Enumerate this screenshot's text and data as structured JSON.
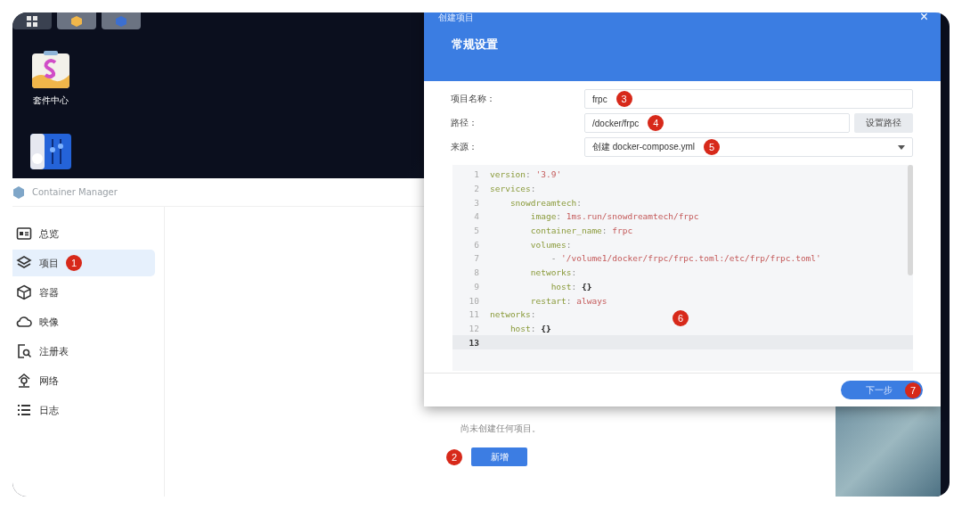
{
  "desktop": {
    "icons": [
      {
        "label": "套件中心",
        "kind": "store"
      },
      {
        "kind": "settings"
      }
    ],
    "taskbar": [
      {
        "kind": "grid",
        "selected": false
      },
      {
        "kind": "store",
        "selected": true
      },
      {
        "kind": "container",
        "selected": true
      }
    ]
  },
  "app_window": {
    "title": "Container Manager",
    "sidebar": {
      "items": [
        {
          "label": "总览",
          "kind": "overview",
          "selected": false
        },
        {
          "label": "项目",
          "kind": "layers",
          "selected": true,
          "badge": "1"
        },
        {
          "label": "容器",
          "kind": "cube",
          "selected": false
        },
        {
          "label": "映像",
          "kind": "cloud",
          "selected": false
        },
        {
          "label": "注册表",
          "kind": "registry",
          "selected": false
        },
        {
          "label": "网络",
          "kind": "network",
          "selected": false
        },
        {
          "label": "日志",
          "kind": "list",
          "selected": false
        }
      ]
    },
    "empty_message": "尚未创建任何项目。",
    "add_button": {
      "label": "新增",
      "badge": "2"
    }
  },
  "dialog": {
    "title": "创建项目",
    "close": "×",
    "heading": "常规设置",
    "fields": [
      {
        "label": "项目名称：",
        "value": "frpc",
        "kind": "text",
        "badge": "3"
      },
      {
        "label": "路径：",
        "value": "/docker/frpc",
        "kind": "path",
        "button": "设置路径",
        "badge": "4"
      },
      {
        "label": "来源：",
        "value": "创建 docker-compose.yml",
        "kind": "select",
        "badge": "5"
      }
    ],
    "editor": {
      "badge": "6",
      "lines": [
        {
          "number": "1",
          "selected": false,
          "tokens": [
            {
              "text": "version",
              "kind": "key"
            },
            {
              "text": ": ",
              "kind": "punct"
            },
            {
              "text": "'3.9'",
              "kind": "string"
            }
          ]
        },
        {
          "number": "2",
          "selected": false,
          "tokens": [
            {
              "text": "services",
              "kind": "key"
            },
            {
              "text": ":",
              "kind": "punct"
            }
          ]
        },
        {
          "number": "3",
          "selected": false,
          "tokens": [
            {
              "text": "    snowdreamtech",
              "kind": "key"
            },
            {
              "text": ":",
              "kind": "punct"
            }
          ]
        },
        {
          "number": "4",
          "selected": false,
          "tokens": [
            {
              "text": "        image",
              "kind": "key"
            },
            {
              "text": ": ",
              "kind": "punct"
            },
            {
              "text": "1ms.run/snowdreamtech/frpc",
              "kind": "string"
            }
          ]
        },
        {
          "number": "5",
          "selected": false,
          "tokens": [
            {
              "text": "        container_name",
              "kind": "key"
            },
            {
              "text": ": ",
              "kind": "punct"
            },
            {
              "text": "frpc",
              "kind": "string"
            }
          ]
        },
        {
          "number": "6",
          "selected": false,
          "tokens": [
            {
              "text": "        volumes",
              "kind": "key"
            },
            {
              "text": ":",
              "kind": "punct"
            }
          ]
        },
        {
          "number": "7",
          "selected": false,
          "tokens": [
            {
              "text": "            - ",
              "kind": "punct"
            },
            {
              "text": "'/volume1/docker/frpc/frpc.toml:/etc/frp/frpc.toml'",
              "kind": "string"
            }
          ]
        },
        {
          "number": "8",
          "selected": false,
          "tokens": [
            {
              "text": "        networks",
              "kind": "key"
            },
            {
              "text": ":",
              "kind": "punct"
            }
          ]
        },
        {
          "number": "9",
          "selected": false,
          "tokens": [
            {
              "text": "            host",
              "kind": "key"
            },
            {
              "text": ": ",
              "kind": "punct"
            },
            {
              "text": "{}",
              "kind": "brace"
            }
          ]
        },
        {
          "number": "10",
          "selected": false,
          "tokens": [
            {
              "text": "        restart",
              "kind": "key"
            },
            {
              "text": ": ",
              "kind": "punct"
            },
            {
              "text": "always",
              "kind": "string"
            }
          ]
        },
        {
          "number": "11",
          "selected": false,
          "tokens": [
            {
              "text": "networks",
              "kind": "key"
            },
            {
              "text": ":",
              "kind": "punct"
            }
          ]
        },
        {
          "number": "12",
          "selected": false,
          "tokens": [
            {
              "text": "    host",
              "kind": "key"
            },
            {
              "text": ": ",
              "kind": "punct"
            },
            {
              "text": "{}",
              "kind": "brace"
            }
          ]
        },
        {
          "number": "13",
          "selected": true
        }
      ]
    },
    "next_button": {
      "label": "下一步",
      "badge": "7"
    }
  }
}
